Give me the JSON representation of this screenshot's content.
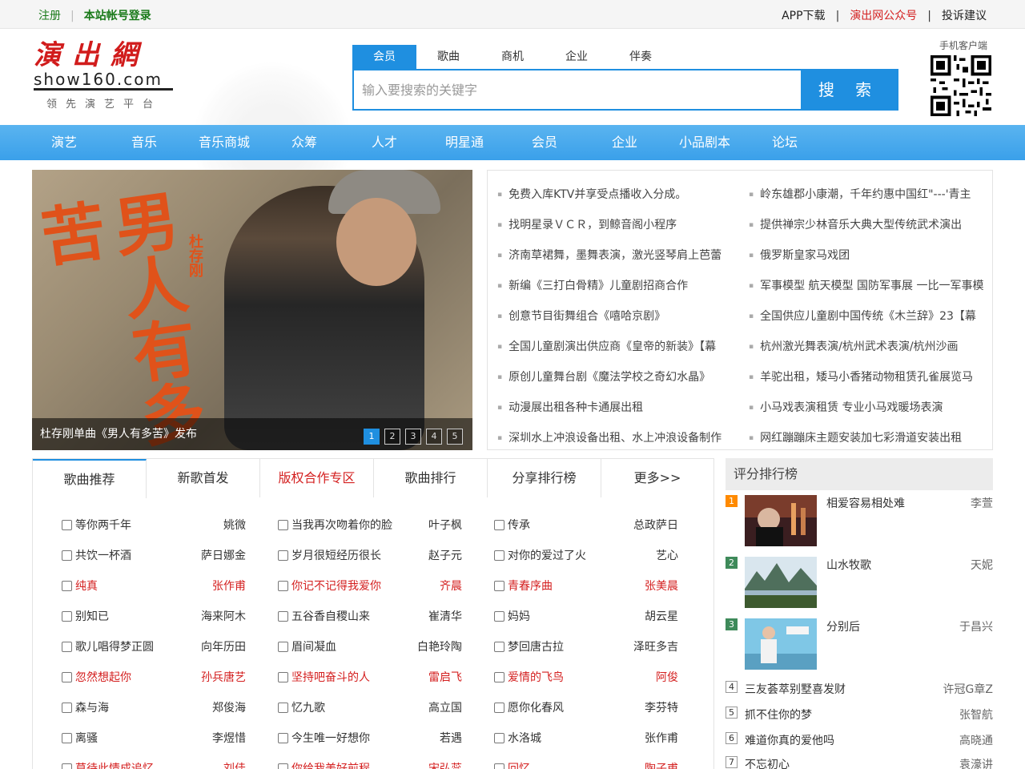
{
  "topbar": {
    "register": "注册",
    "login": "本站帐号登录",
    "app": "APP下载",
    "wechat": "演出网公众号",
    "complaint": "投诉建议"
  },
  "logo": {
    "cn": "演出網",
    "en": "show160.com",
    "slogan": "领先演艺平台"
  },
  "search": {
    "tabs": [
      "会员",
      "歌曲",
      "商机",
      "企业",
      "伴奏"
    ],
    "placeholder": "输入要搜索的关键字",
    "button": "搜 索"
  },
  "qr_label": "手机客户端",
  "nav": [
    "演艺",
    "音乐",
    "音乐商城",
    "众筹",
    "人才",
    "明星通",
    "会员",
    "企业",
    "小品剧本",
    "论坛"
  ],
  "banner": {
    "title": "男人有多苦",
    "singer": "杜存刚",
    "caption": "杜存刚单曲《男人有多苦》发布",
    "dots": [
      "1",
      "2",
      "3",
      "4",
      "5"
    ]
  },
  "news": {
    "left": [
      "免费入库KTV并享受点播收入分成。",
      "找明星录ＶＣＲ，到鲸音阁小程序",
      "济南草裙舞，墨舞表演，激光竖琴肩上芭蕾",
      "新编《三打白骨精》儿童剧招商合作",
      "创意节目街舞组合《嘻哈京剧》",
      "全国儿童剧演出供应商《皇帝的新装》【幕",
      "原创儿童舞台剧《魔法学校之奇幻水晶》",
      "动漫展出租各种卡通展出租",
      "深圳水上冲浪设备出租、水上冲浪设备制作"
    ],
    "right": [
      "岭东雄郡小康潮，千年约惠中国红\"---'青主",
      "提供禅宗少林音乐大典大型传统武术演出",
      "俄罗斯皇家马戏团",
      "军事模型 航天模型 国防军事展 一比一军事模",
      "全国供应儿童剧中国传统《木兰辞》23【幕",
      "杭州激光舞表演/杭州武术表演/杭州沙画",
      "羊驼出租，矮马小香猪动物租赁孔雀展览马",
      "小马戏表演租赁 专业小马戏暖场表演",
      "网红蹦蹦床主题安装加七彩滑道安装出租"
    ]
  },
  "songs": {
    "tabs": [
      "歌曲推荐",
      "新歌首发",
      "版权合作专区",
      "歌曲排行",
      "分享排行榜",
      "更多>>"
    ],
    "rows": [
      [
        {
          "t": "等你两千年",
          "a": "姚微"
        },
        {
          "t": "当我再次吻着你的脸",
          "a": "叶子枫"
        },
        {
          "t": "传承",
          "a": "总政萨日"
        }
      ],
      [
        {
          "t": "共饮一杯酒",
          "a": "萨日娜金"
        },
        {
          "t": "岁月很短经历很长",
          "a": "赵子元"
        },
        {
          "t": "对你的爱过了火",
          "a": "艺心"
        }
      ],
      [
        {
          "t": "纯真",
          "a": "张作甫",
          "red": true
        },
        {
          "t": "你记不记得我爱你",
          "a": "齐晨",
          "red": true
        },
        {
          "t": "青春序曲",
          "a": "张美晨",
          "red": true
        }
      ],
      [
        {
          "t": "别知已",
          "a": "海来阿木"
        },
        {
          "t": "五谷香自稷山来",
          "a": "崔清华"
        },
        {
          "t": "妈妈",
          "a": "胡云星"
        }
      ],
      [
        {
          "t": "歌儿唱得梦正圆",
          "a": "向年历田"
        },
        {
          "t": "眉间凝血",
          "a": "白艳玲陶"
        },
        {
          "t": "梦回唐古拉",
          "a": "泽旺多吉"
        }
      ],
      [
        {
          "t": "忽然想起你",
          "a": "孙兵唐艺",
          "red": true
        },
        {
          "t": "坚持吧奋斗的人",
          "a": "雷启飞",
          "red": true
        },
        {
          "t": "爱情的飞鸟",
          "a": "阿俊",
          "red": true
        }
      ],
      [
        {
          "t": "森与海",
          "a": "郑俊海"
        },
        {
          "t": "忆九歌",
          "a": "高立国"
        },
        {
          "t": "愿你化春风",
          "a": "李芬特"
        }
      ],
      [
        {
          "t": "离骚",
          "a": "李煜惜"
        },
        {
          "t": "今生唯一好想你",
          "a": "若遇"
        },
        {
          "t": "水洛城",
          "a": "张作甫"
        }
      ],
      [
        {
          "t": "莫待此情成追忆",
          "a": "刘佳",
          "red": true
        },
        {
          "t": "你给我美好前程",
          "a": "宋弘蕊",
          "red": true
        },
        {
          "t": "回忆",
          "a": "陶子甫",
          "red": true
        }
      ]
    ]
  },
  "rank": {
    "title": "评分排行榜",
    "top": [
      {
        "n": "1",
        "song": "相爱容易相处难",
        "singer": "李萱"
      },
      {
        "n": "2",
        "song": "山水牧歌",
        "singer": "天妮"
      },
      {
        "n": "3",
        "song": "分别后",
        "singer": "于昌兴"
      }
    ],
    "rest": [
      {
        "n": "4",
        "song": "三友荟萃别墅喜发财",
        "singer": "许冠G章Z"
      },
      {
        "n": "5",
        "song": "抓不住你的梦",
        "singer": "张智航"
      },
      {
        "n": "6",
        "song": "难道你真的爱他吗",
        "singer": "高晓通"
      },
      {
        "n": "7",
        "song": "不忘初心",
        "singer": "袁濠讲"
      }
    ]
  },
  "colors": {
    "accent": "#1f8fe0",
    "red": "#d42020",
    "green": "#1a7a1a"
  }
}
